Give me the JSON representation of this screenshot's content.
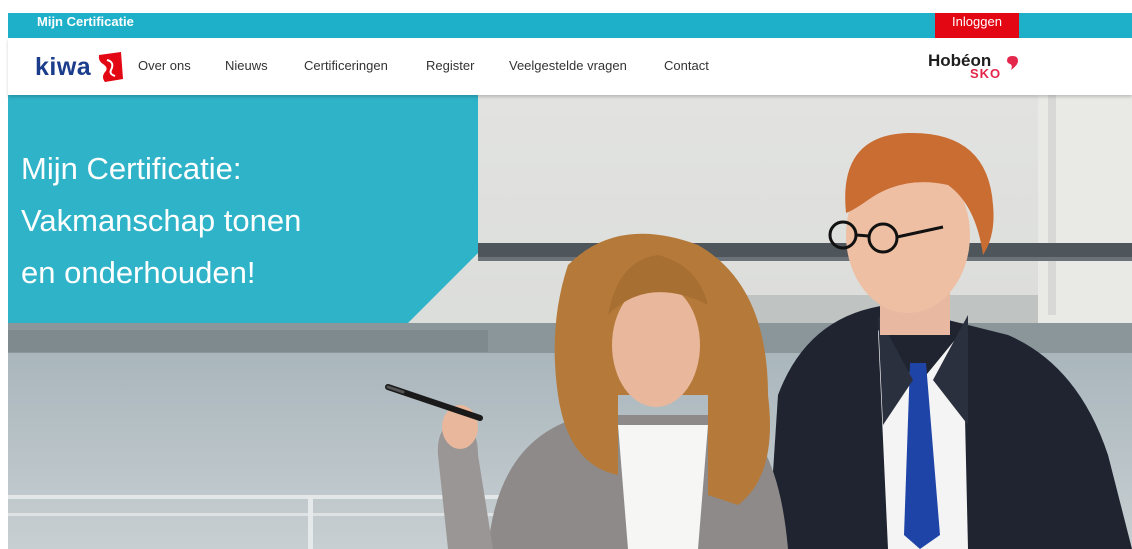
{
  "topbar": {
    "site_title": "Mijn Certificatie",
    "login_label": "Inloggen"
  },
  "logos": {
    "kiwa": "kiwa",
    "hobeon": "Hobéon",
    "sko": "SKO"
  },
  "nav": {
    "items": [
      {
        "label": "Over ons"
      },
      {
        "label": "Nieuws"
      },
      {
        "label": "Certificeringen"
      },
      {
        "label": "Register"
      },
      {
        "label": "Veelgestelde vragen"
      },
      {
        "label": "Contact"
      }
    ]
  },
  "hero": {
    "heading_lines": [
      "Mijn Certificatie:",
      "Vakmanschap tonen",
      "en onderhouden!"
    ]
  },
  "colors": {
    "topbar": "#1fb0c9",
    "login_button": "#e30613",
    "kiwa_blue": "#1c3c8c",
    "kiwa_red": "#e30613",
    "hobeon_pink": "#e3264a",
    "hero_panel": "#20afc6"
  }
}
